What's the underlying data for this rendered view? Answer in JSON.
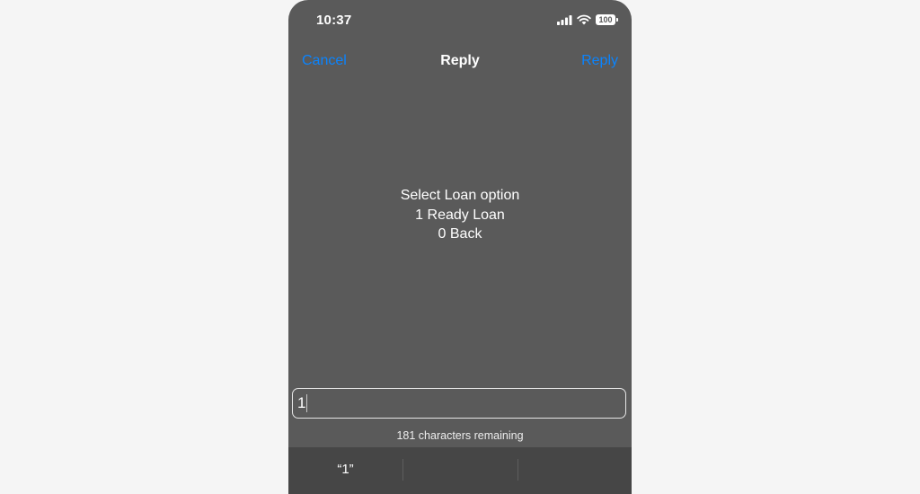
{
  "status_bar": {
    "time": "10:37",
    "battery": "100",
    "icons": [
      "cellular-signal-icon",
      "wifi-icon",
      "battery-icon"
    ]
  },
  "nav": {
    "cancel_label": "Cancel",
    "title": "Reply",
    "reply_label": "Reply",
    "accent_color": "#0a84ff"
  },
  "message": {
    "lines": [
      "Select Loan option",
      "1 Ready Loan",
      "0 Back"
    ]
  },
  "reply_input": {
    "value": "1",
    "placeholder": ""
  },
  "char_counter": "181 characters remaining",
  "suggestions": [
    "“1”",
    "",
    ""
  ],
  "colors": {
    "screen_bg": "#5a5a5a",
    "keyboard_bar_bg": "#464646",
    "page_bg": "#f5f5f5"
  }
}
